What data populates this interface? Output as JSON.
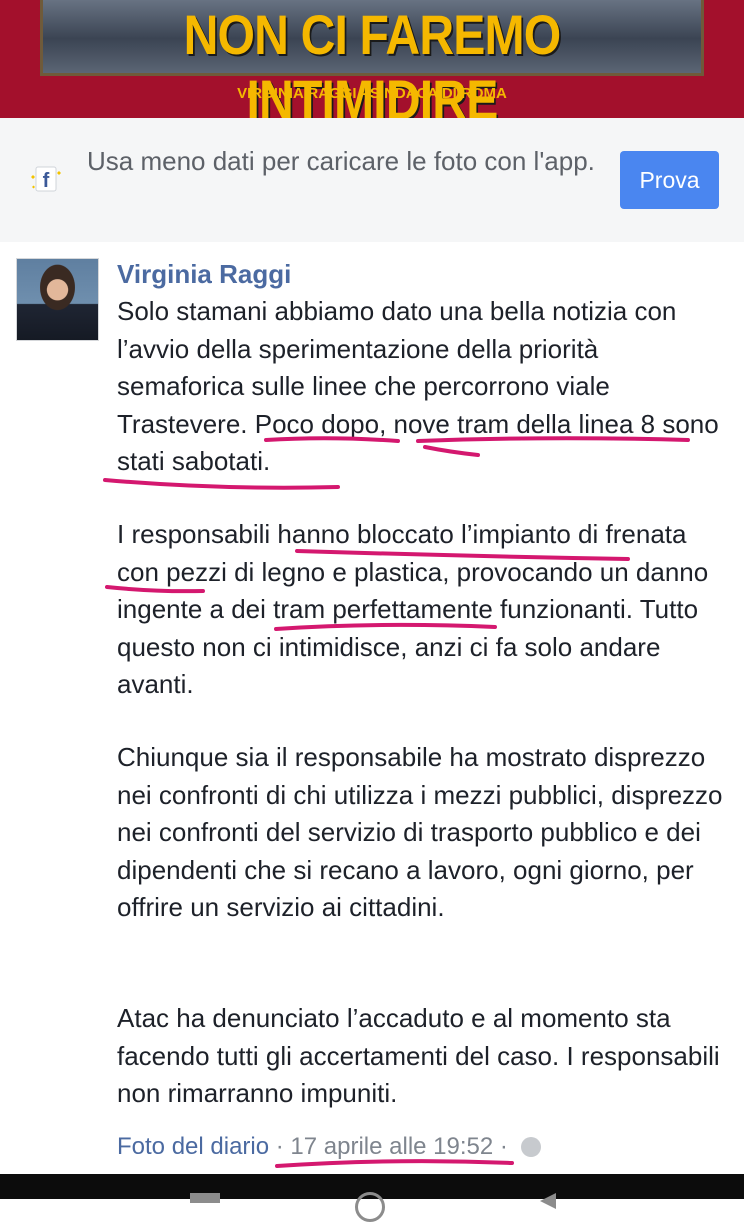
{
  "banner": {
    "title": "NON CI FAREMO INTIMIDIRE",
    "subtitle": "VIRGINIA RAGGI - SINDACA DI ROMA"
  },
  "promo": {
    "text": "Usa meno dati per caricare le foto con l'app.",
    "button_label": "Prova",
    "icon": "facebook-app-icon"
  },
  "post": {
    "author": "Virginia Raggi",
    "paragraphs": [
      "Solo stamani abbiamo dato una bella notizia con l’avvio della sperimentazione della priorità semaforica sulle linee che percorrono viale Trastevere. Poco dopo, nove tram della linea 8 sono stati sabotati.",
      "I responsabili hanno bloccato l’impianto di frenata con pezzi di legno e plastica, provocando un danno ingente a dei tram perfettamente funzionanti. Tutto questo non ci intimidisce, anzi ci fa solo andare avanti.",
      "Chiunque sia il responsabile ha mostrato disprezzo nei confronti di chi utilizza i mezzi pubblici, disprezzo nei confronti del servizio di trasporto pubblico e dei dipendenti che si recano a lavoro, ogni giorno, per offrire un servizio ai cittadini.",
      "Atac ha denunciato l’accaduto e al momento sta facendo tutti gli accertamenti del caso. I responsabili non rimarranno impuniti."
    ],
    "footer": {
      "link": "Foto del diario",
      "separator": " · ",
      "timestamp": "17 aprile alle 19:52",
      "separator2": " · ",
      "privacy_icon": "globe-icon"
    }
  },
  "colors": {
    "banner_bg": "#a3102c",
    "banner_text": "#f5b800",
    "button_blue": "#4a86f0",
    "author_blue": "#4b6aa1",
    "annotation_pink": "#d4186f"
  }
}
